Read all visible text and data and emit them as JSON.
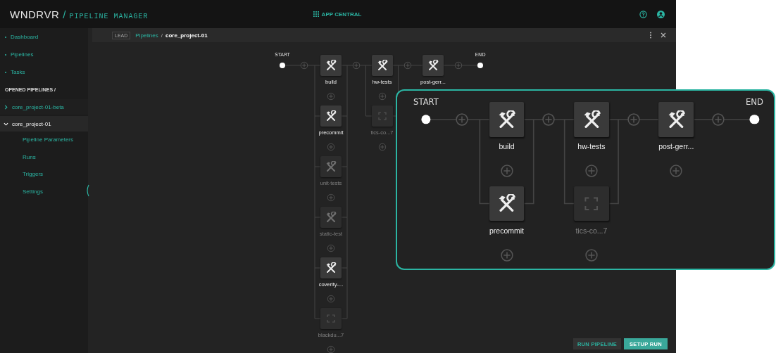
{
  "header": {
    "logo": "WNDRVR",
    "separator": "/",
    "app_name": "PIPELINE MANAGER",
    "app_central": "APP CENTRAL"
  },
  "sidebar": {
    "nav": [
      {
        "label": "Dashboard"
      },
      {
        "label": "Pipelines"
      },
      {
        "label": "Tasks"
      }
    ],
    "section_title": "OPENED PIPELINES /",
    "pipelines": [
      {
        "name": "core_project-01-beta",
        "expanded": false
      },
      {
        "name": "core_project-01",
        "expanded": true,
        "children": [
          {
            "label": "Pipeline Parameters"
          },
          {
            "label": "Runs"
          },
          {
            "label": "Triggers"
          },
          {
            "label": "Settings"
          }
        ]
      }
    ]
  },
  "breadcrumb": {
    "badge": "LEAD",
    "link": "Pipelines",
    "separator": "/",
    "current": "core_project-01"
  },
  "graph": {
    "start_label": "START",
    "end_label": "END",
    "columns": [
      {
        "nodes": [
          {
            "label": "build",
            "kind": "task",
            "disabled": false
          },
          {
            "label": "precommit",
            "kind": "task",
            "disabled": false
          },
          {
            "label": "unit-tests",
            "kind": "task",
            "disabled": true
          },
          {
            "label": "static-test",
            "kind": "task",
            "disabled": true
          },
          {
            "label": "coverity-...",
            "kind": "task",
            "disabled": false
          },
          {
            "label": "blackdu...7",
            "kind": "placeholder",
            "disabled": true
          }
        ]
      },
      {
        "nodes": [
          {
            "label": "hw-tests",
            "kind": "task",
            "disabled": false
          },
          {
            "label": "tics-co...7",
            "kind": "placeholder",
            "disabled": true
          }
        ]
      },
      {
        "nodes": [
          {
            "label": "post-gerr...",
            "kind": "task",
            "disabled": false
          }
        ]
      }
    ]
  },
  "inset": {
    "start_label": "START",
    "end_label": "END",
    "columns": [
      {
        "nodes": [
          {
            "label": "build",
            "kind": "task",
            "disabled": false
          },
          {
            "label": "precommit",
            "kind": "task",
            "disabled": false
          }
        ]
      },
      {
        "nodes": [
          {
            "label": "hw-tests",
            "kind": "task",
            "disabled": false
          },
          {
            "label": "tics-co...7",
            "kind": "placeholder",
            "disabled": true
          }
        ]
      },
      {
        "nodes": [
          {
            "label": "post-gerr...",
            "kind": "task",
            "disabled": false
          }
        ]
      }
    ]
  },
  "buttons": [
    {
      "label": "RUN PIPELINE",
      "kind": "secondary"
    },
    {
      "label": "SETUP RUN",
      "kind": "primary"
    }
  ]
}
